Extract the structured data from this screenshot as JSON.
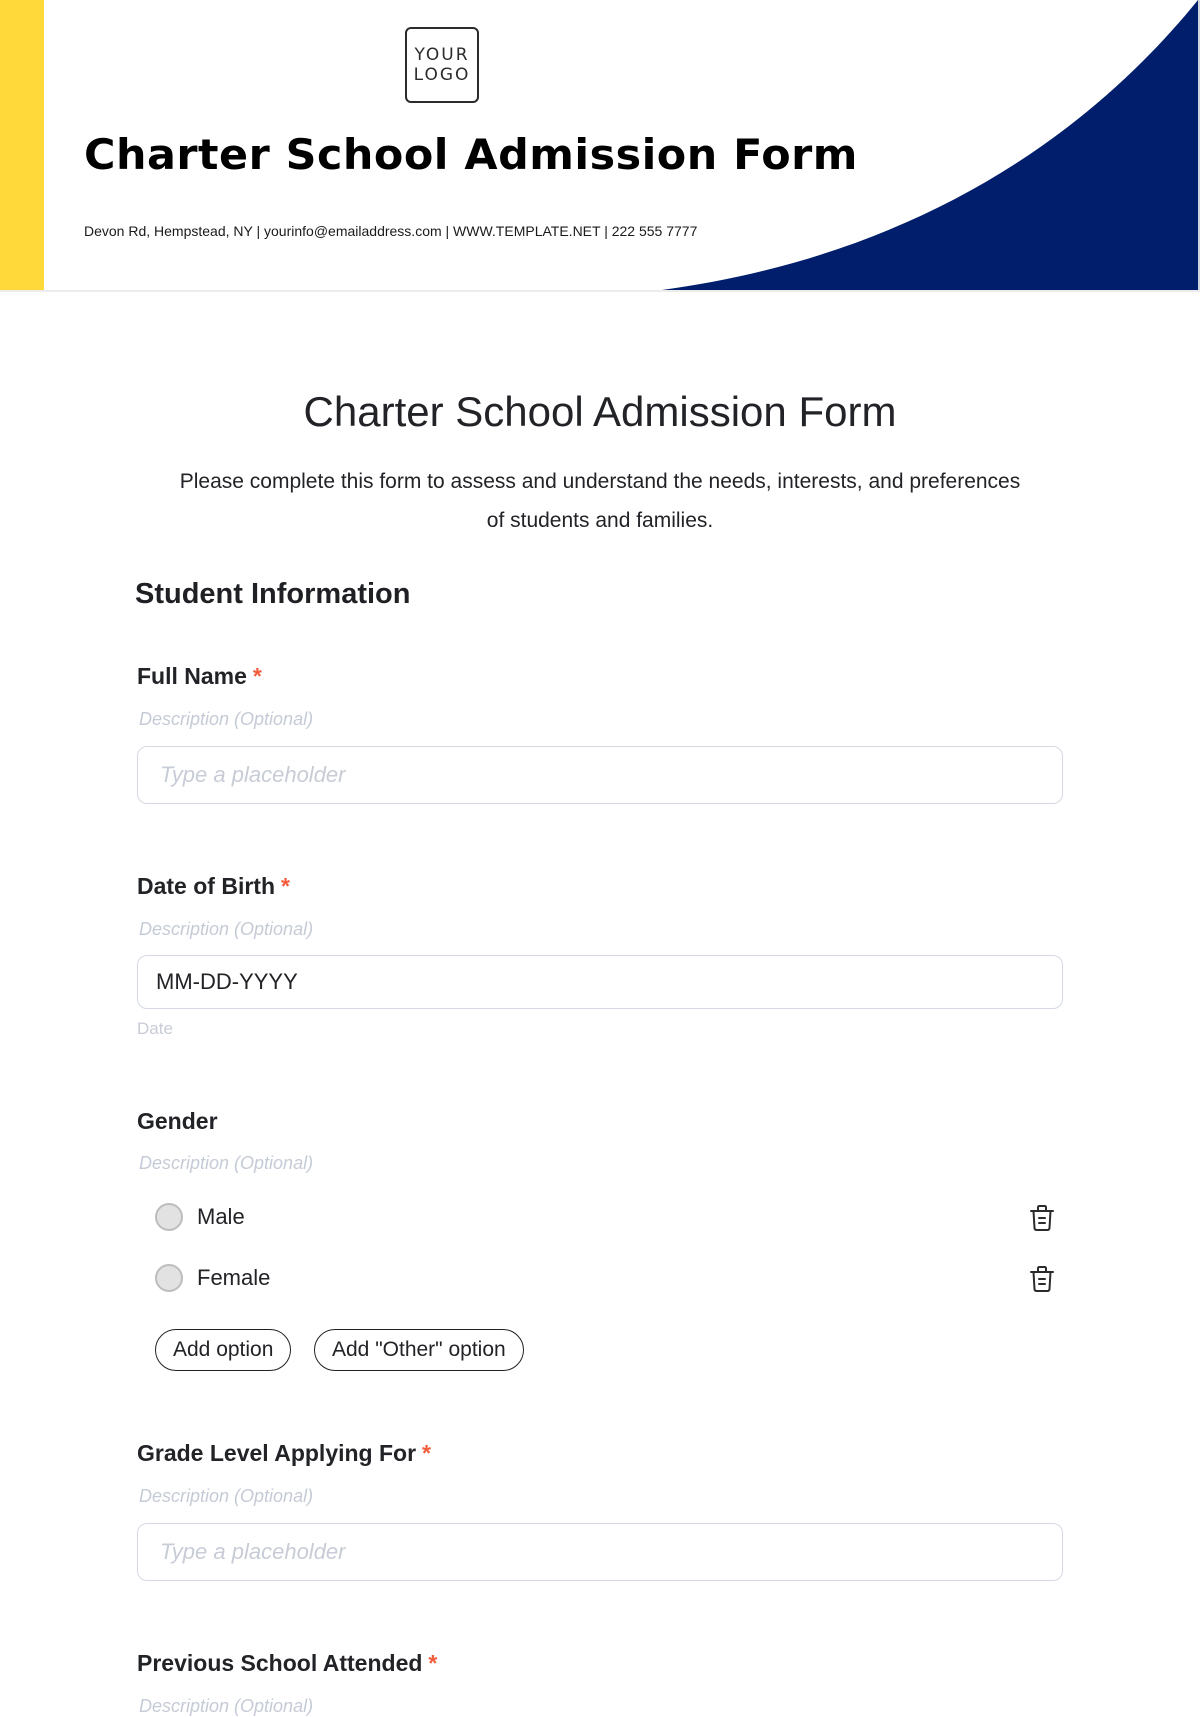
{
  "header": {
    "logo_line1": "YOUR",
    "logo_line2": "LOGO",
    "title": "Charter School Admission Form",
    "contact": "Devon Rd, Hempstead, NY | yourinfo@emailaddress.com | WWW.TEMPLATE.NET | 222 555 7777",
    "accent_yellow": "#ffd83a",
    "accent_blue": "#001e6b"
  },
  "form": {
    "title": "Charter School Admission Form",
    "description": "Please complete this form to assess and understand the needs, interests, and preferences of students and families.",
    "section_title": "Student Information",
    "required_mark": "*",
    "questions": [
      {
        "label": "Full Name",
        "required": true,
        "description": "Description (Optional)",
        "placeholder": "Type a placeholder"
      },
      {
        "label": "Date of Birth",
        "required": true,
        "description": "Description (Optional)",
        "value": "MM-DD-YYYY",
        "help": "Date"
      },
      {
        "label": "Gender",
        "required": false,
        "description": "Description (Optional)",
        "options": [
          "Male",
          "Female"
        ],
        "add_option_label": "Add option",
        "add_other_label": "Add \"Other\" option"
      },
      {
        "label": "Grade Level Applying For",
        "required": true,
        "description": "Description (Optional)",
        "placeholder": "Type a placeholder"
      },
      {
        "label": "Previous School Attended",
        "required": true,
        "description": "Description (Optional)"
      }
    ]
  }
}
